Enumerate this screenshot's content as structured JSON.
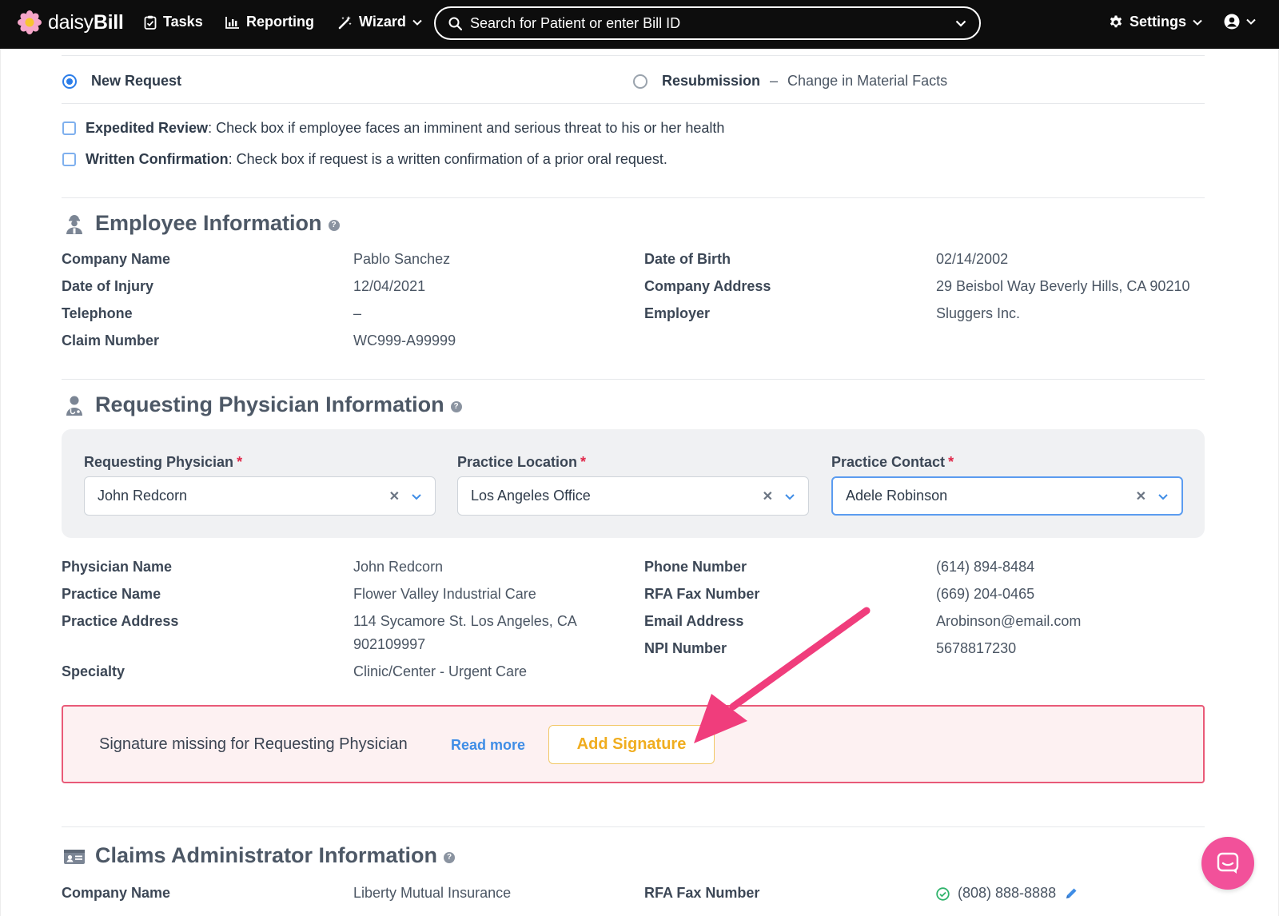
{
  "nav": {
    "logo_text_light": "daisy",
    "logo_text_bold": "Bill",
    "tasks": "Tasks",
    "reporting": "Reporting",
    "wizard": "Wizard",
    "search_placeholder": "Search for Patient or enter Bill ID",
    "settings": "Settings"
  },
  "request_type": {
    "new_request": "New Request",
    "resubmission_bold": "Resubmission",
    "resubmission_sep": "–",
    "resubmission_rest": "Change in Material Facts",
    "selected": "new_request"
  },
  "checkboxes": [
    {
      "title": "Expedited Review",
      "text": ": Check box if employee faces an imminent and serious threat to his or her health"
    },
    {
      "title": "Written Confirmation",
      "text": ": Check box if request is a written confirmation of a prior oral request."
    }
  ],
  "employee": {
    "title": "Employee Information",
    "left": [
      {
        "label": "Company Name",
        "value": "Pablo Sanchez"
      },
      {
        "label": "Date of Injury",
        "value": "12/04/2021"
      },
      {
        "label": "Telephone",
        "value": "–"
      },
      {
        "label": "Claim Number",
        "value": "WC999-A99999"
      }
    ],
    "right": [
      {
        "label": "Date of Birth",
        "value": "02/14/2002"
      },
      {
        "label": "Company Address",
        "value": "29 Beisbol Way Beverly Hills, CA 90210"
      },
      {
        "label": "Employer",
        "value": "Sluggers Inc."
      }
    ]
  },
  "physician": {
    "title": "Requesting Physician Information",
    "selects": [
      {
        "label": "Requesting Physician",
        "required": "*",
        "value": "John Redcorn"
      },
      {
        "label": "Practice Location",
        "required": "*",
        "value": "Los Angeles Office"
      },
      {
        "label": "Practice Contact",
        "required": "*",
        "value": "Adele Robinson"
      }
    ],
    "left": [
      {
        "label": "Physician Name",
        "value": "John Redcorn"
      },
      {
        "label": "Practice Name",
        "value": "Flower Valley Industrial Care"
      },
      {
        "label": "Practice Address",
        "value": "114 Sycamore St. Los Angeles, CA",
        "value2": "902109997"
      },
      {
        "label": "Specialty",
        "value": "Clinic/Center - Urgent Care"
      }
    ],
    "right": [
      {
        "label": "Phone Number",
        "value": "(614) 894-8484"
      },
      {
        "label": "RFA Fax Number",
        "value": "(669) 204-0465"
      },
      {
        "label": "Email Address",
        "value": "Arobinson@email.com"
      },
      {
        "label": "NPI Number",
        "value": "5678817230"
      }
    ]
  },
  "alert": {
    "message": "Signature missing for Requesting Physician",
    "read_more": "Read more",
    "add_signature": "Add Signature"
  },
  "claims": {
    "title": "Claims Administrator Information",
    "left": [
      {
        "label": "Company Name",
        "value": "Liberty Mutual Insurance"
      }
    ],
    "right": [
      {
        "label": "RFA Fax Number",
        "value": "(808) 888-8888"
      }
    ]
  },
  "colors": {
    "nav_bg": "#0d0d0d",
    "accent_blue": "#2b7de9",
    "alert_border": "#e95a78",
    "alert_bg": "#fdf1f2",
    "signature_gold": "#f0ad1f",
    "annotation_arrow": "#f03d7c",
    "chat_pink": "#f2519a"
  },
  "icons": {
    "logo": "daisy-flower-icon",
    "tasks": "clipboard-check-icon",
    "reporting": "bar-chart-icon",
    "wizard": "magic-wand-icon",
    "search": "search-icon",
    "settings": "gear-icon",
    "account": "user-circle-icon",
    "employee": "worker-icon",
    "physician": "doctor-icon",
    "claims": "id-card-icon",
    "help": "question-icon",
    "chat": "chat-bubble-icon"
  }
}
